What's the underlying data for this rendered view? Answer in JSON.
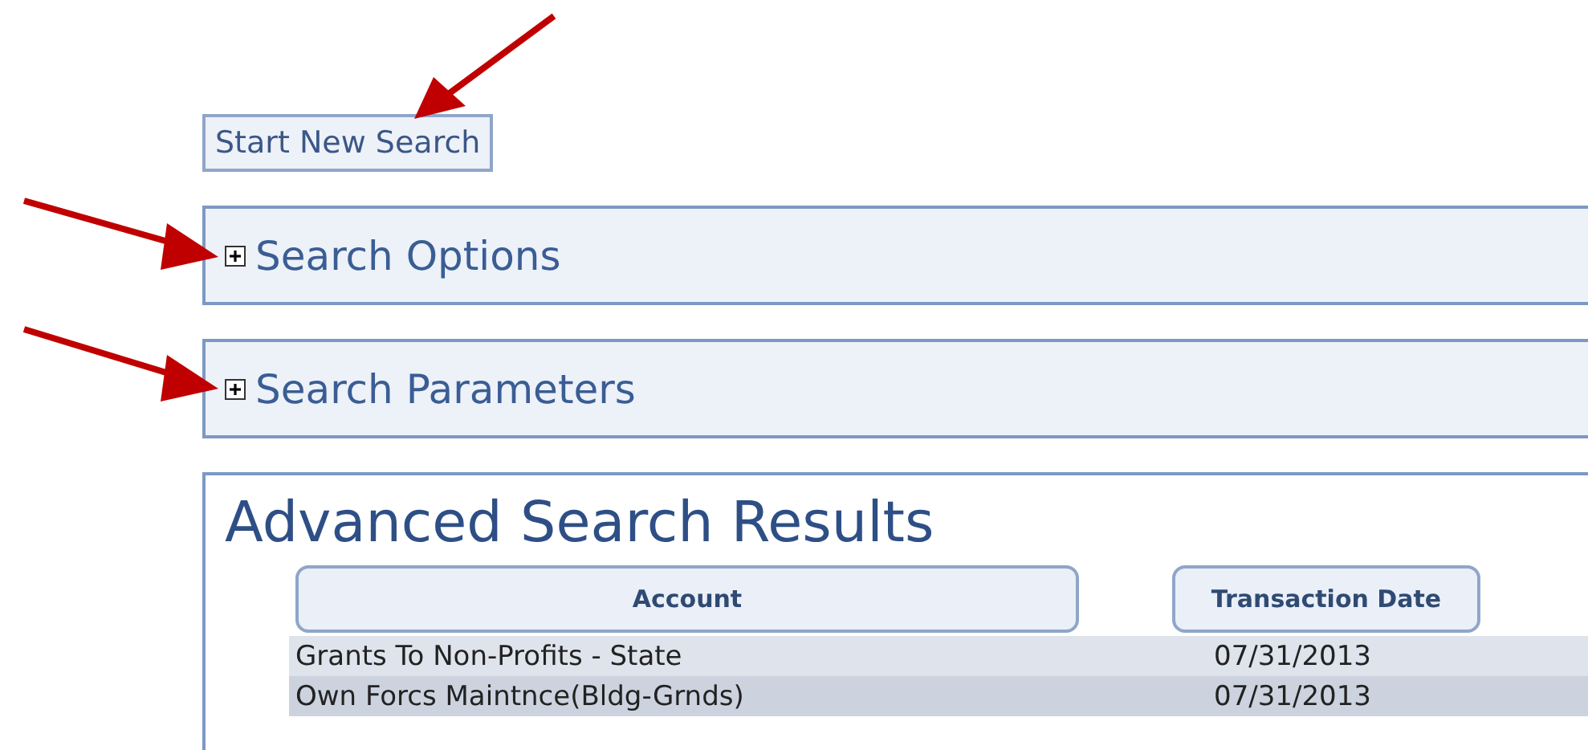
{
  "start_button": "Start New Search",
  "sections": [
    {
      "title": "Search Options",
      "expanded": false
    },
    {
      "title": "Search Parameters",
      "expanded": false
    }
  ],
  "results": {
    "title": "Advanced Search Results",
    "columns": [
      "Account",
      "Transaction Date"
    ],
    "rows": [
      [
        "Grants To Non-Profits - State",
        "07/31/2013"
      ],
      [
        "Own Forcs Maintnce(Bldg-Grnds)",
        "07/31/2013"
      ]
    ]
  }
}
